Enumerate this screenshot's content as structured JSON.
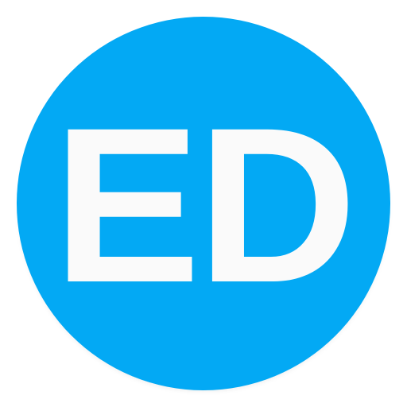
{
  "icon": {
    "monogram": "ED",
    "icon_name": "circle-app-icon",
    "colors": {
      "circle": "#03a9f4",
      "text": "#fafafa",
      "background": "#ffffff"
    }
  }
}
